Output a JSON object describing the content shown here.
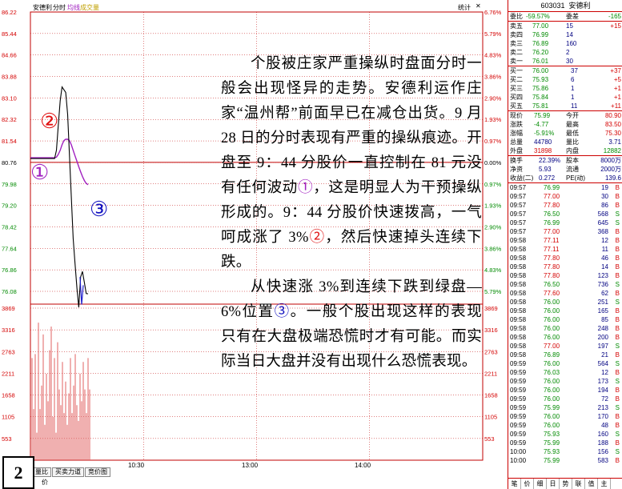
{
  "header": {
    "stock_name": "安德利",
    "mode": "分时",
    "avg_label": "均线",
    "vol_label": "成交量",
    "stats_label": "统计",
    "close_label": "✕"
  },
  "y_price_ticks": [
    "86.22",
    "85.44",
    "84.66",
    "83.88",
    "83.10",
    "82.32",
    "81.54",
    "80.76",
    "79.98",
    "79.20",
    "78.42",
    "77.64",
    "76.86",
    "76.08"
  ],
  "y_pct_ticks": [
    "6.76%",
    "5.79%",
    "4.83%",
    "3.86%",
    "2.90%",
    "1.93%",
    "0.97%",
    "0.00%",
    "0.97%",
    "1.93%",
    "2.90%",
    "3.86%",
    "4.83%",
    "5.79%"
  ],
  "vol_ticks": [
    "3869",
    "3316",
    "2763",
    "2211",
    "1658",
    "1105",
    "553"
  ],
  "time_ticks": [
    "10:30",
    "13:00",
    "14:00"
  ],
  "bottom_tabs": [
    "量比",
    "买卖力道",
    "竞价图"
  ],
  "bottom_partial": "价",
  "figure_number": "2",
  "annotation": {
    "p1_a": "个股被庄家严重操纵时盘面分时一般会出现怪异的走势。安德利运作庄家“温州帮”前面早已在减仓出货。9 月 28 日的分时表现有严重的操纵痕迹。开盘至 9：44 分股价一直控制在 81 元没有任何波动",
    "m1": "①",
    "p1_b": "，这是明显人为干预操纵形成的。9：44 分股价快速拨高，一气呵成涨了 3%",
    "m2": "②",
    "p1_c": "，然后快速掉头连续下跌。",
    "p2_a": "从快速涨 3%到连续下跌到绿盘—6%位置",
    "m3": "③",
    "p2_b": "。一般个股出现这样的表现只有在大盘极端恐慌时才有可能。而实际当日大盘并没有出现什么恐慌表现。"
  },
  "markers": {
    "m1": "①",
    "m2": "②",
    "m3": "③"
  },
  "quote": {
    "code": "603031",
    "name": "安德利",
    "weibi_label": "委比",
    "weibi_value": "-59.57%",
    "weicha_label": "委差",
    "weicha_value": "-165",
    "sells": [
      {
        "label": "卖五",
        "price": "77.00",
        "vol": "15",
        "chg": "+15"
      },
      {
        "label": "卖四",
        "price": "76.99",
        "vol": "14",
        "chg": ""
      },
      {
        "label": "卖三",
        "price": "76.89",
        "vol": "160",
        "chg": ""
      },
      {
        "label": "卖二",
        "price": "76.20",
        "vol": "2",
        "chg": ""
      },
      {
        "label": "卖一",
        "price": "76.01",
        "vol": "30",
        "chg": ""
      }
    ],
    "buys": [
      {
        "label": "买一",
        "price": "76.00",
        "vol": "37",
        "chg": "+37"
      },
      {
        "label": "买二",
        "price": "75.93",
        "vol": "6",
        "chg": "+5"
      },
      {
        "label": "买三",
        "price": "75.86",
        "vol": "1",
        "chg": "+1"
      },
      {
        "label": "买四",
        "price": "75.84",
        "vol": "1",
        "chg": "+1"
      },
      {
        "label": "买五",
        "price": "75.81",
        "vol": "11",
        "chg": "+11"
      }
    ],
    "stats": [
      {
        "l1": "现价",
        "v1": "75.99",
        "l2": "今开",
        "v2": "80.90"
      },
      {
        "l1": "涨跌",
        "v1": "-4.77",
        "l2": "最高",
        "v2": "83.50"
      },
      {
        "l1": "涨幅",
        "v1": "-5.91%",
        "l2": "最低",
        "v2": "75.30"
      },
      {
        "l1": "总量",
        "v1": "44780",
        "l2": "量比",
        "v2": "3.71"
      },
      {
        "l1": "外盘",
        "v1": "31898",
        "l2": "内盘",
        "v2": "12882"
      }
    ],
    "stats2": [
      {
        "l1": "换手",
        "v1": "22.39%",
        "l2": "股本",
        "v2": "8000万"
      },
      {
        "l1": "净资",
        "v1": "5.93",
        "l2": "流通",
        "v2": "2000万"
      },
      {
        "l1": "收益(二)",
        "v1": "0.272",
        "l2": "PE(动)",
        "v2": "139.6"
      }
    ]
  },
  "ticks": [
    {
      "t": "09:57",
      "p": "76.99",
      "v": "19",
      "s": "B"
    },
    {
      "t": "09:57",
      "p": "77.00",
      "v": "30",
      "s": "B"
    },
    {
      "t": "09:57",
      "p": "77.80",
      "v": "86",
      "s": "B"
    },
    {
      "t": "09:57",
      "p": "76.50",
      "v": "568",
      "s": "S"
    },
    {
      "t": "09:57",
      "p": "76.99",
      "v": "645",
      "s": "S"
    },
    {
      "t": "09:57",
      "p": "77.00",
      "v": "368",
      "s": "B"
    },
    {
      "t": "09:58",
      "p": "77.11",
      "v": "12",
      "s": "B"
    },
    {
      "t": "09:58",
      "p": "77.11",
      "v": "11",
      "s": "B"
    },
    {
      "t": "09:58",
      "p": "77.80",
      "v": "46",
      "s": "B"
    },
    {
      "t": "09:58",
      "p": "77.80",
      "v": "14",
      "s": "B"
    },
    {
      "t": "09:58",
      "p": "77.80",
      "v": "123",
      "s": "B"
    },
    {
      "t": "09:58",
      "p": "76.50",
      "v": "736",
      "s": "S"
    },
    {
      "t": "09:58",
      "p": "77.60",
      "v": "62",
      "s": "B"
    },
    {
      "t": "09:58",
      "p": "76.00",
      "v": "251",
      "s": "S"
    },
    {
      "t": "09:58",
      "p": "76.00",
      "v": "165",
      "s": "B"
    },
    {
      "t": "09:58",
      "p": "76.00",
      "v": "85",
      "s": "B"
    },
    {
      "t": "09:58",
      "p": "76.00",
      "v": "248",
      "s": "B"
    },
    {
      "t": "09:58",
      "p": "76.00",
      "v": "200",
      "s": "B"
    },
    {
      "t": "09:58",
      "p": "77.00",
      "v": "197",
      "s": "S"
    },
    {
      "t": "09:58",
      "p": "76.89",
      "v": "21",
      "s": "B"
    },
    {
      "t": "09:59",
      "p": "76.00",
      "v": "564",
      "s": "S"
    },
    {
      "t": "09:59",
      "p": "76.03",
      "v": "12",
      "s": "B"
    },
    {
      "t": "09:59",
      "p": "76.00",
      "v": "173",
      "s": "S"
    },
    {
      "t": "09:59",
      "p": "76.00",
      "v": "194",
      "s": "B"
    },
    {
      "t": "09:59",
      "p": "76.00",
      "v": "72",
      "s": "B"
    },
    {
      "t": "09:59",
      "p": "75.99",
      "v": "213",
      "s": "S"
    },
    {
      "t": "09:59",
      "p": "76.00",
      "v": "170",
      "s": "B"
    },
    {
      "t": "09:59",
      "p": "76.00",
      "v": "48",
      "s": "B"
    },
    {
      "t": "09:59",
      "p": "75.93",
      "v": "160",
      "s": "S"
    },
    {
      "t": "09:59",
      "p": "75.99",
      "v": "188",
      "s": "B"
    },
    {
      "t": "10:00",
      "p": "75.93",
      "v": "156",
      "s": "S"
    },
    {
      "t": "10:00",
      "p": "75.99",
      "v": "583",
      "s": "B"
    }
  ],
  "right_tabs": [
    "笔",
    "价",
    "细",
    "日",
    "势",
    "联",
    "值",
    "主",
    "筹"
  ],
  "colors": {
    "grid": "#c00000",
    "price_line": "#000000",
    "avg_line": "#a020c0",
    "up": "#d40000",
    "down": "#008a00",
    "marker1": "#a020c0",
    "marker2": "#e01010",
    "marker3": "#1010c0",
    "vol_bar": "#e06060"
  },
  "price_series": {
    "y_values": [
      80.9,
      80.9,
      80.9,
      80.9,
      80.9,
      80.9,
      80.9,
      80.9,
      80.9,
      80.9,
      80.9,
      80.9,
      80.9,
      80.9,
      81.2,
      82.1,
      83.0,
      83.5,
      83.4,
      83.3,
      82.5,
      81.0,
      79.5,
      78.0,
      77.1,
      76.2,
      75.5,
      76.6,
      76.8,
      76.4,
      76.0,
      75.99
    ]
  },
  "avg_series": {
    "y_values": [
      80.93,
      80.93,
      80.93,
      80.93,
      80.93,
      80.93,
      80.93,
      80.93,
      80.93,
      80.93,
      80.93,
      80.93,
      80.93,
      80.93,
      80.95,
      81.05,
      81.2,
      81.4,
      81.55,
      81.6,
      81.6,
      81.55,
      81.4,
      81.2,
      81.0,
      80.8,
      80.6,
      80.42,
      80.25,
      80.1,
      80.0,
      79.95
    ]
  },
  "vol_series": {
    "y_values": [
      2600,
      1300,
      2700,
      700,
      3500,
      1300,
      1900,
      3200,
      900,
      2200,
      1500,
      2800,
      3400,
      1100,
      2600,
      700,
      3000,
      1800,
      1400,
      2500,
      1200,
      2000,
      900,
      1700,
      2600,
      1200,
      1900,
      2700,
      1400,
      1000,
      2200,
      1500,
      2500,
      1800,
      1200,
      2600,
      1800
    ]
  }
}
